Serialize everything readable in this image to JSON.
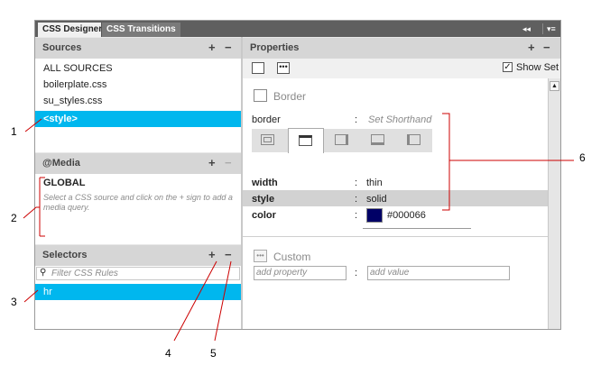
{
  "tabs": {
    "css_designer": "CSS Designer",
    "css_transitions": "CSS Transitions"
  },
  "sources": {
    "title": "Sources",
    "add": "+",
    "remove": "−",
    "items": [
      "ALL SOURCES",
      "boilerplate.css",
      "su_styles.css",
      "<style>"
    ]
  },
  "media": {
    "title": "@Media",
    "add": "+",
    "remove": "−",
    "global": "GLOBAL",
    "hint": "Select a CSS source and click on the + sign to add a media query."
  },
  "selectors": {
    "title": "Selectors",
    "add": "+",
    "remove": "−",
    "filter_placeholder": "Filter CSS Rules",
    "items": [
      "hr"
    ]
  },
  "properties": {
    "title": "Properties",
    "add": "+",
    "remove": "−",
    "show_set": "Show Set",
    "border_section": "Border",
    "border_label": "border",
    "border_value": "Set Shorthand",
    "width_label": "width",
    "width_value": "thin",
    "style_label": "style",
    "style_value": "solid",
    "color_label": "color",
    "color_value": "#000066",
    "custom_section": "Custom",
    "add_property": "add property",
    "add_value": "add value",
    "colon": ":"
  },
  "colors": {
    "accent": "#00b7ee",
    "border_color": "#000066",
    "callout_line": "#cc0000"
  },
  "callouts": [
    "1",
    "2",
    "3",
    "4",
    "5",
    "6"
  ]
}
